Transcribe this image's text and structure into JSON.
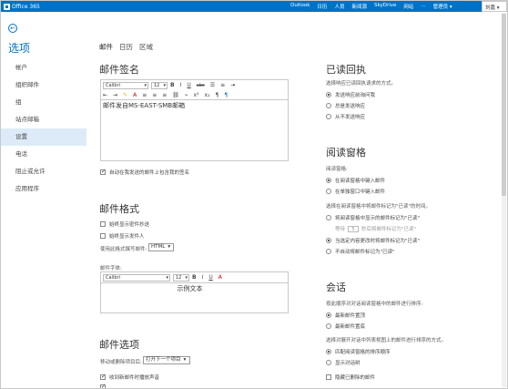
{
  "topbar": {
    "logo_text": "Office 365",
    "nav": [
      "Outlook",
      "日历",
      "人员",
      "新闻源",
      "SkyDrive",
      "网站",
      "...",
      "管理员"
    ],
    "admin_label": "管理员 ▾",
    "user": "刘嘉 ▾"
  },
  "sidebar": {
    "back_icon": "←",
    "title": "选项",
    "items": [
      {
        "label": "帐户"
      },
      {
        "label": "组织邮件"
      },
      {
        "label": "组"
      },
      {
        "label": "站点邮箱"
      },
      {
        "label": "设置"
      },
      {
        "label": "电话"
      },
      {
        "label": "阻止或允许"
      },
      {
        "label": "应用程序"
      }
    ]
  },
  "subnav": [
    "邮件",
    "日历",
    "区域"
  ],
  "signature": {
    "heading": "邮件签名",
    "font": "Calibri",
    "size": "12",
    "content": "邮件发自MS-EAST-SMB邮箱",
    "auto_include": "自动在我发送的邮件上包含我的签名"
  },
  "format": {
    "heading": "邮件格式",
    "show_from": "始终显示密件抄送",
    "show_to": "始终显示发件人",
    "compose_label": "使用此格式撰写邮件:",
    "compose_value": "HTML",
    "font_label": "邮件字体:",
    "font": "Calibri",
    "size": "12",
    "sample": "示例文本"
  },
  "options": {
    "heading": "邮件选项",
    "after_move_label": "移动或删除项目后:",
    "after_move_value": "打开下一个项目",
    "play_sound": "收到新邮件时播放声音"
  },
  "read_receipt": {
    "heading": "已读回执",
    "desc": "选择响应已读回执请求的方式。",
    "options": [
      "发送响应前询问我",
      "总是发送响应",
      "从不发送响应"
    ]
  },
  "reading_pane": {
    "heading": "阅读窗格",
    "pane_label": "阅读窗格:",
    "pane_options": [
      "在阅读窗格中键入邮件",
      "在单独窗口中键入邮件"
    ],
    "mark_label": "选择在阅读窗格中将邮件标记为\"已读\"的时间。",
    "mark_options": [
      "将阅读窗格中显示的邮件标记为\"已读\"",
      "当选定内容更改时将邮件标记为\"已读\"",
      "不自动将邮件标记为\"已读\""
    ],
    "wait_prefix": "等待",
    "wait_value": "5",
    "wait_suffix": "秒后将邮件标记为\"已读\""
  },
  "conversations": {
    "heading": "会话",
    "order_label": "按此顺序对对话阅读窗格中的邮件进行排序:",
    "order_options": [
      "最新邮件置顶",
      "最新邮件置底"
    ],
    "expand_label": "选择对展开对话中列表视图上的邮件进行排序的方式。",
    "expand_options": [
      "匹配阅读窗格的排序顺序",
      "显示对话树"
    ],
    "hide_deleted": "隐藏已删除的邮件"
  },
  "icons": {
    "bold": "B",
    "italic": "I",
    "underline": "U",
    "strike": "abc",
    "color": "A"
  }
}
